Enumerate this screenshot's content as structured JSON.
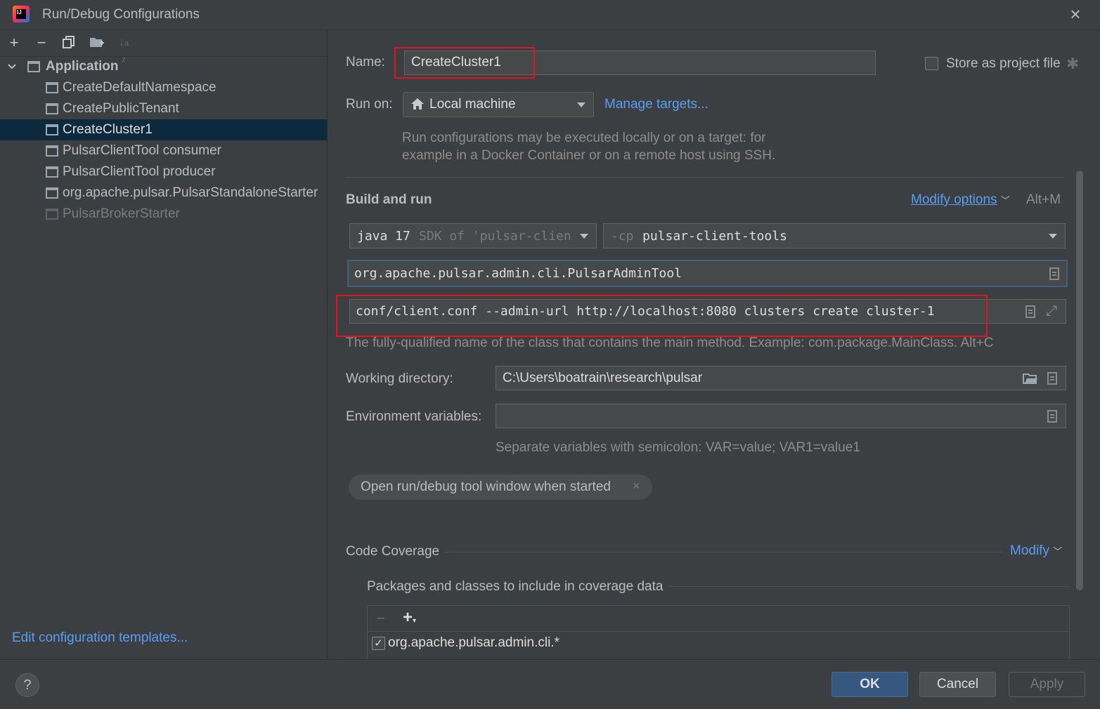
{
  "window": {
    "title": "Run/Debug Configurations"
  },
  "toolbar": {
    "add": "+",
    "remove": "−"
  },
  "tree": {
    "group_label": "Application",
    "items": [
      {
        "label": "CreateDefaultNamespace"
      },
      {
        "label": "CreatePublicTenant"
      },
      {
        "label": "CreateCluster1"
      },
      {
        "label": "PulsarClientTool consumer"
      },
      {
        "label": "PulsarClientTool producer"
      },
      {
        "label": "org.apache.pulsar.PulsarStandaloneStarter"
      },
      {
        "label": "PulsarBrokerStarter"
      }
    ],
    "selected_index": 2
  },
  "left_footer": {
    "edit_templates": "Edit configuration templates..."
  },
  "form": {
    "name_label": "Name:",
    "name_value": "CreateCluster1",
    "store_as_project_file": "Store as project file",
    "run_on_label": "Run on:",
    "run_on_value": "Local machine",
    "manage_targets": "Manage targets...",
    "run_on_hint_1": "Run configurations may be executed locally or on a target: for",
    "run_on_hint_2": "example in a Docker Container or on a remote host using SSH.",
    "build_and_run": "Build and run",
    "modify_options": "Modify options",
    "modify_options_shortcut": "Alt+M",
    "sdk_java": "java 17",
    "sdk_hint": "SDK of 'pulsar-clien",
    "cp_prefix": "-cp",
    "cp_value": "pulsar-client-tools",
    "main_class": "org.apache.pulsar.admin.cli.PulsarAdminTool",
    "program_args": "conf/client.conf --admin-url http://localhost:8080 clusters create cluster-1",
    "main_class_hint": "The fully-qualified name of the class that contains the main method. Example: com.package.MainClass. Alt+C",
    "working_dir_label": "Working directory:",
    "working_dir_value": "C:\\Users\\boatrain\\research\\pulsar",
    "env_label": "Environment variables:",
    "env_value": "",
    "env_hint": "Separate variables with semicolon: VAR=value; VAR1=value1",
    "open_tool_window_chip": "Open run/debug tool window when started",
    "code_coverage": "Code Coverage",
    "coverage_modify": "Modify",
    "packages_label": "Packages and classes to include in coverage data",
    "coverage_entry": "org.apache.pulsar.admin.cli.*",
    "coverage_entry_checked": true
  },
  "buttons": {
    "help": "?",
    "ok": "OK",
    "cancel": "Cancel",
    "apply": "Apply"
  },
  "colors": {
    "accent": "#589df6",
    "selection": "#0d293e",
    "highlight_box": "#e81123",
    "ok_button": "#365880"
  }
}
